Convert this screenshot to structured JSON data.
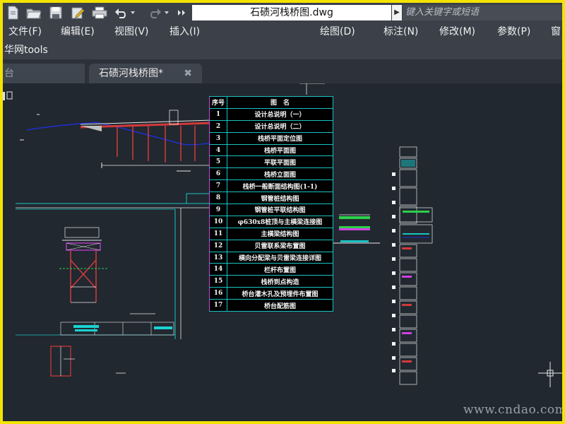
{
  "app": {
    "document_title": "石碛河栈桥图.dwg",
    "search_placeholder": "键入关键字或短语",
    "tools_label": "华网tools"
  },
  "menu": [
    "文件(F)",
    "编辑(E)",
    "视图(V)",
    "插入(I)",
    "绘图(D)",
    "标注(N)",
    "修改(M)",
    "参数(P)",
    "窗"
  ],
  "tabs": {
    "start": "台",
    "drawing": "石碛河栈桥图*",
    "close_glyph": "✖"
  },
  "sheet_index": {
    "header": {
      "num": "序号",
      "name": "图　名"
    },
    "rows": [
      {
        "num": "1",
        "name": "设计总说明（一）"
      },
      {
        "num": "2",
        "name": "设计总说明（二）"
      },
      {
        "num": "3",
        "name": "栈桥平面定位图"
      },
      {
        "num": "4",
        "name": "栈桥平面图"
      },
      {
        "num": "5",
        "name": "平联平面图"
      },
      {
        "num": "6",
        "name": "栈桥立面图"
      },
      {
        "num": "7",
        "name": "栈桥一般断面结构图(1-1)"
      },
      {
        "num": "8",
        "name": "钢管桩结构图"
      },
      {
        "num": "9",
        "name": "钢管桩平联结构图"
      },
      {
        "num": "10",
        "name": "φ630x8桩顶与主横梁连接图"
      },
      {
        "num": "11",
        "name": "主横梁结构图"
      },
      {
        "num": "12",
        "name": "贝雷联系梁布置图"
      },
      {
        "num": "13",
        "name": "横向分配梁与贝雷梁连接详图"
      },
      {
        "num": "14",
        "name": "栏杆布置图"
      },
      {
        "num": "15",
        "name": "栈桥到点构造"
      },
      {
        "num": "16",
        "name": "桥台灌木孔及预埋件布置图"
      },
      {
        "num": "17",
        "name": "桥台配筋图"
      }
    ]
  },
  "watermark": "www.cndao.com",
  "colors": {
    "cad_background": "#212830",
    "table_border": "#19c3c3",
    "frame": "#f3e400"
  }
}
